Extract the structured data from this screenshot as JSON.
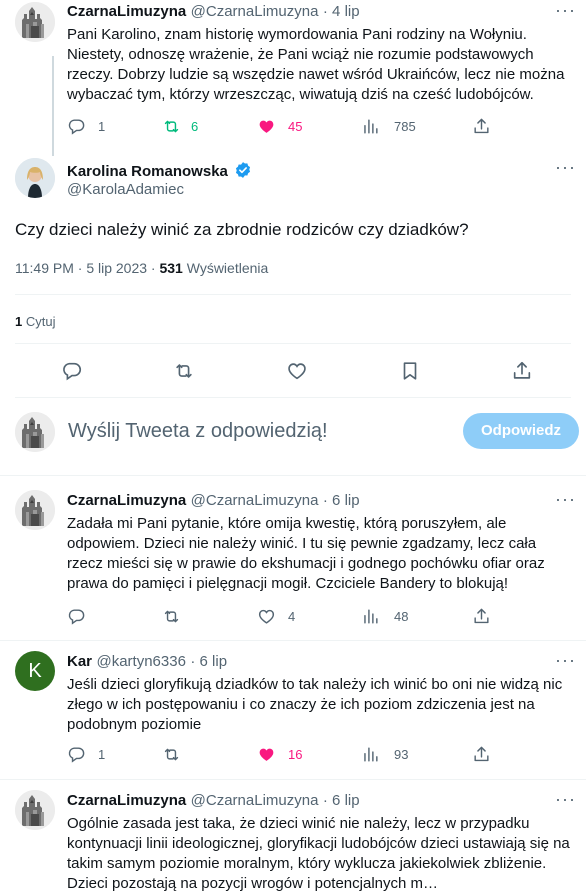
{
  "tweets": [
    {
      "name": "CzarnaLimuzyna",
      "handle": "@CzarnaLimuzyna",
      "date": "· 4 lip",
      "text": "Pani Karolino, znam historię wymordowania Pani rodziny na Wołyniu. Niestety, odnoszę wrażenie, że Pani wciąż nie rozumie podstawowych rzeczy. Dobrzy ludzie są wszędzie nawet wśród Ukraińców, lecz nie można wybaczać tym, którzy wrzeszcząc, wiwatują dziś na cześć ludobójców.",
      "replies": "1",
      "retweets": "6",
      "likes": "45",
      "views": "785"
    },
    {
      "name": "CzarnaLimuzyna",
      "handle": "@CzarnaLimuzyna",
      "date": "· 6 lip",
      "text": "Zadała mi Pani pytanie, które omija kwestię, którą poruszyłem, ale odpowiem. Dzieci nie należy winić. I tu się pewnie zgadzamy, lecz cała rzecz mieści się w prawie do ekshumacji i godnego pochówku ofiar oraz prawa do pamięci i pielęgnacji mogił.  Czciciele Bandery to blokują!",
      "replies": "",
      "retweets": "",
      "likes": "4",
      "views": "48"
    },
    {
      "name": "Kar",
      "handle": "@kartyn6336",
      "date": "· 6 lip",
      "text": "Jeśli dzieci gloryfikują dziadków to tak należy ich winić bo oni nie widzą nic złego w ich postępowaniu i co znaczy że ich poziom zdziczenia jest na podobnym poziomie",
      "replies": "1",
      "retweets": "",
      "likes": "16",
      "views": "93",
      "avatar_letter": "K"
    },
    {
      "name": "CzarnaLimuzyna",
      "handle": "@CzarnaLimuzyna",
      "date": "· 6 lip",
      "text": "Ogólnie zasada jest taka, że dzieci winić nie należy, lecz w przypadku kontynuacji linii ideologicznej, gloryfikacji ludobójców dzieci ustawiają się na takim samym poziomie moralnym, który wyklucza jakiekolwiek zbliżenie. Dzieci pozostają na pozycji wrogów i potencjalnych m…"
    }
  ],
  "main": {
    "name": "Karolina Romanowska",
    "handle": "@KarolaAdamiec",
    "text": "Czy dzieci należy winić za zbrodnie rodziców czy dziadków?",
    "time": "11:49 PM · 5 lip 2023 · ",
    "views_count": "531",
    "views_label": " Wyświetlenia",
    "quotes_count": "1",
    "quotes_label": " Cytuj"
  },
  "reply_box": {
    "placeholder": "Wyślij Tweeta z odpowiedzią!",
    "button": "Odpowiedz"
  },
  "colors": {
    "accent": "#1d9bf0",
    "like": "#f91880",
    "retweet": "#00ba7c",
    "muted": "#536471",
    "kar_avatar": "#2f6f1f"
  },
  "icons": {
    "reply": "reply-icon",
    "retweet": "retweet-icon",
    "like": "heart-icon",
    "views": "views-icon",
    "share": "share-icon",
    "bookmark": "bookmark-icon",
    "more": "more-icon",
    "verified": "verified-badge-icon"
  }
}
